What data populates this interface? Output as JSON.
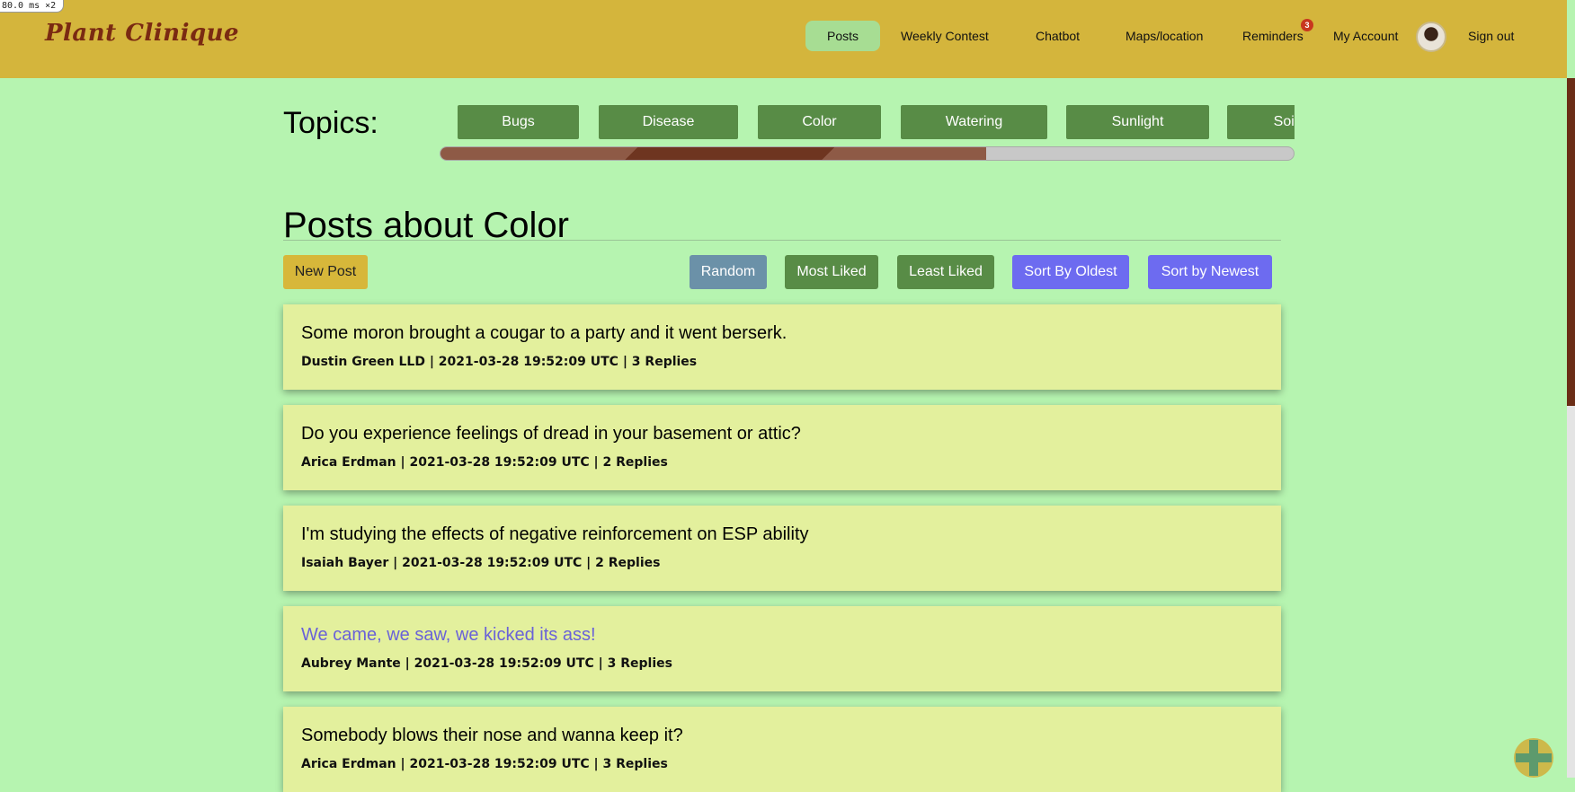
{
  "debug": {
    "label": "80.0 ms ×2"
  },
  "navbar": {
    "brand": "Plant Clinique",
    "items": [
      {
        "label": "Posts",
        "active": true
      },
      {
        "label": "Weekly Contest"
      },
      {
        "label": "Chatbot"
      },
      {
        "label": "Maps/location"
      },
      {
        "label": "Reminders",
        "badge": "3"
      },
      {
        "label": "My Account"
      },
      {
        "label": "Sign out"
      }
    ]
  },
  "topics": {
    "label": "Topics:",
    "items": [
      "Bugs",
      "Disease",
      "Color",
      "Watering",
      "Sunlight",
      "Soil"
    ],
    "scroll_progress_percent": 64
  },
  "page": {
    "heading": "Posts about Color"
  },
  "actions": {
    "new_post": "New Post",
    "random": "Random",
    "most_liked": "Most Liked",
    "least_liked": "Least Liked",
    "sort_oldest": "Sort By Oldest",
    "sort_newest": "Sort by Newest"
  },
  "posts": [
    {
      "title": "Some moron brought a cougar to a party and it went berserk.",
      "meta": "Dustin Green LLD | 2021-03-28 19:52:09 UTC | 3 Replies"
    },
    {
      "title": "Do you experience feelings of dread in your basement or attic?",
      "meta": "Arica Erdman | 2021-03-28 19:52:09 UTC | 2 Replies"
    },
    {
      "title": "I'm studying the effects of negative reinforcement on ESP ability",
      "meta": "Isaiah Bayer | 2021-03-28 19:52:09 UTC | 2 Replies"
    },
    {
      "title": "We came, we saw, we kicked its ass!",
      "meta": "Aubrey Mante | 2021-03-28 19:52:09 UTC | 3 Replies",
      "hovered": true
    },
    {
      "title": "Somebody blows their nose and wanna keep it?",
      "meta": "Arica Erdman | 2021-03-28 19:52:09 UTC | 3 Replies"
    }
  ],
  "colors": {
    "navbar": "#d4b53c",
    "page_bg": "#b6f4b0",
    "topic_button": "#588c46",
    "card_bg": "#e3f09d",
    "sort_blue": "#6d6bf0",
    "link_hover": "#6a62d8"
  }
}
